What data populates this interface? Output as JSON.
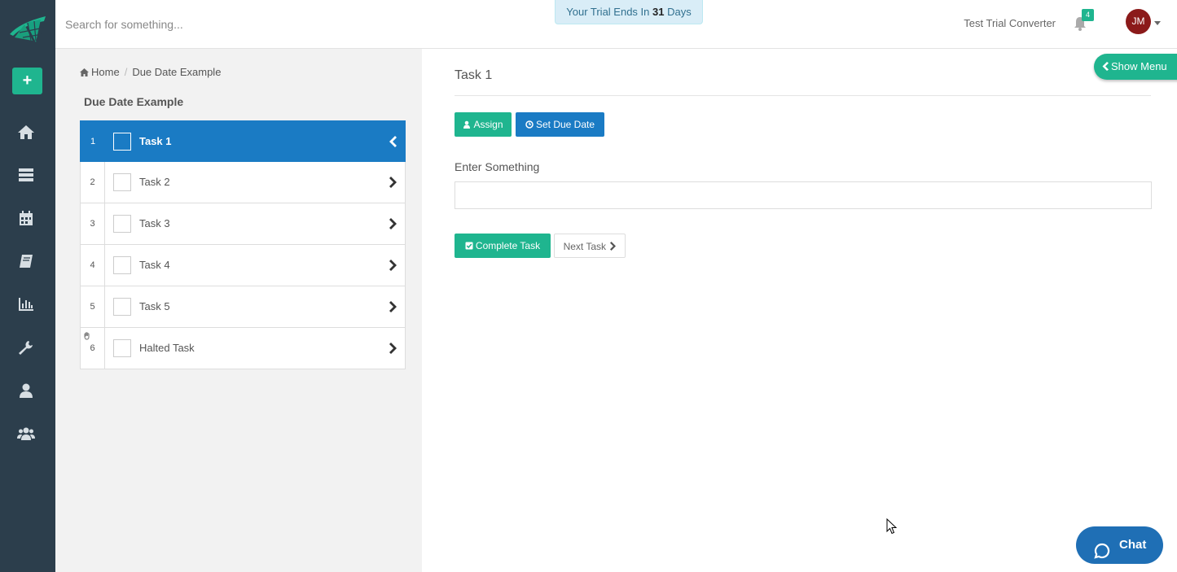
{
  "search": {
    "placeholder": "Search for something..."
  },
  "trial": {
    "prefix": "Your Trial Ends In",
    "days": "31",
    "suffix": "Days"
  },
  "header": {
    "org_name": "Test Trial Converter",
    "notification_count": "4",
    "avatar_initials": "JM"
  },
  "sidebar": {
    "add_label": "+",
    "items": [
      "home-icon",
      "server-icon",
      "calendar-icon",
      "book-icon",
      "bar-chart-icon",
      "wrench-icon",
      "user-icon",
      "users-icon"
    ]
  },
  "breadcrumb": {
    "home": "Home",
    "separator": "/",
    "current": "Due Date Example"
  },
  "checklist": {
    "title": "Due Date Example",
    "tasks": [
      {
        "num": "1",
        "label": "Task 1",
        "active": true
      },
      {
        "num": "2",
        "label": "Task 2",
        "active": false
      },
      {
        "num": "3",
        "label": "Task 3",
        "active": false
      },
      {
        "num": "4",
        "label": "Task 4",
        "active": false
      },
      {
        "num": "5",
        "label": "Task 5",
        "active": false
      },
      {
        "num": "6",
        "label": "Halted Task",
        "active": false,
        "halted": true
      }
    ]
  },
  "task": {
    "title": "Task 1",
    "assign_label": "Assign",
    "due_label": "Set Due Date",
    "field_label": "Enter Something",
    "field_value": "",
    "complete_label": "Complete Task",
    "next_label": "Next Task"
  },
  "show_menu_label": "Show Menu",
  "chat_label": "Chat",
  "colors": {
    "rail": "#2c3e4c",
    "accent_green": "#1fb58f",
    "accent_blue": "#1a7bc4",
    "trial_bg": "#d9edf7"
  }
}
